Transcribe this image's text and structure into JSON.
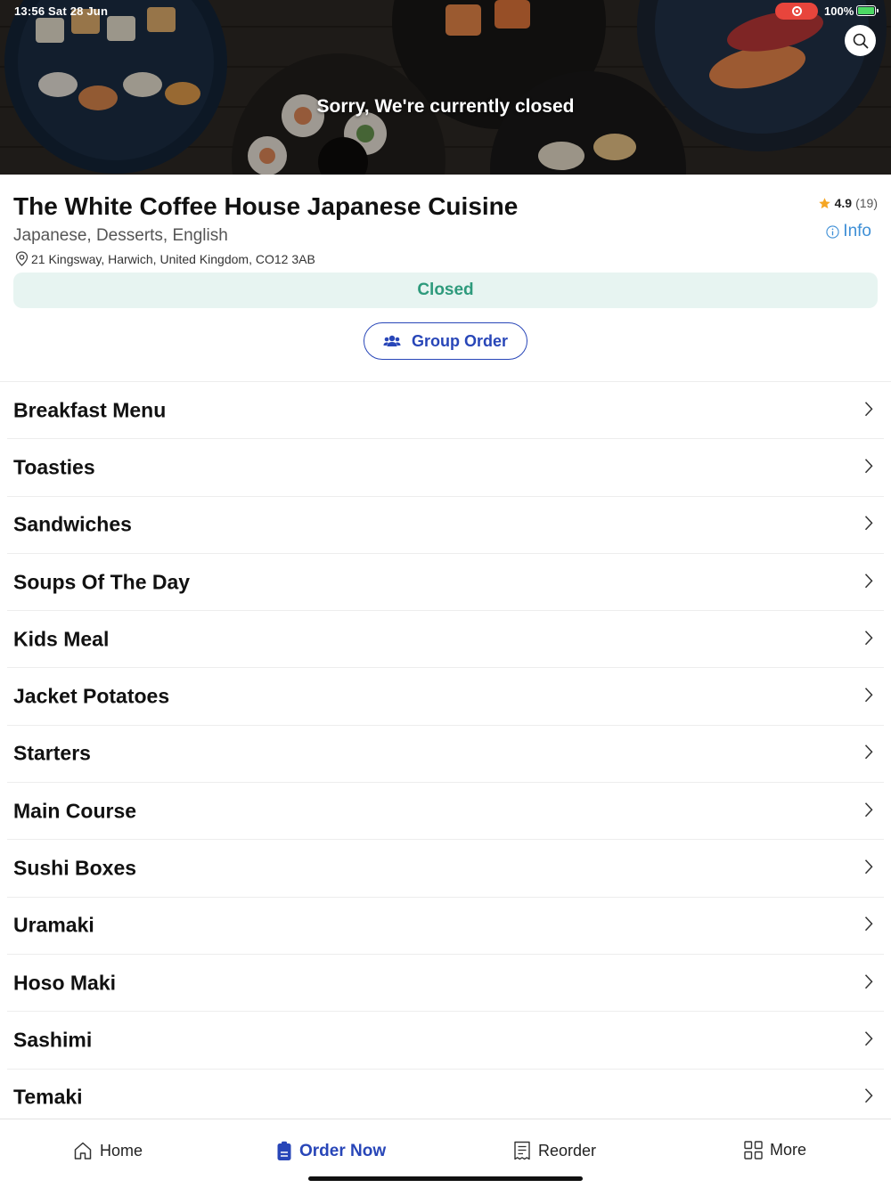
{
  "status_bar": {
    "time": "13:56  Sat 28 Jun",
    "battery": "100%"
  },
  "hero": {
    "closed_message": "Sorry, We're currently closed"
  },
  "restaurant": {
    "name": "The White Coffee House Japanese Cuisine",
    "cuisines": "Japanese, Desserts, English",
    "address": "21 Kingsway, Harwich, United Kingdom, CO12 3AB",
    "rating": "4.9",
    "rating_count": "(19)",
    "info_label": "Info",
    "status": "Closed",
    "group_order_label": "Group Order"
  },
  "menu": {
    "categories": [
      "Breakfast Menu",
      "Toasties",
      "Sandwiches",
      "Soups Of The Day",
      "Kids Meal",
      "Jacket Potatoes",
      "Starters",
      "Main Course",
      "Sushi Boxes",
      "Uramaki",
      "Hoso Maki",
      "Sashimi",
      "Temaki"
    ]
  },
  "tabbar": {
    "tabs": [
      {
        "label": "Home",
        "icon": "home-icon",
        "active": false
      },
      {
        "label": "Order Now",
        "icon": "order-icon",
        "active": true
      },
      {
        "label": "Reorder",
        "icon": "receipt-icon",
        "active": false
      },
      {
        "label": "More",
        "icon": "grid-icon",
        "active": false
      }
    ]
  },
  "colors": {
    "accent": "#2846b8",
    "closed_text": "#2e9a7c",
    "closed_bg": "#e7f4f1",
    "info_link": "#3e8fd6",
    "star": "#f5a623"
  }
}
